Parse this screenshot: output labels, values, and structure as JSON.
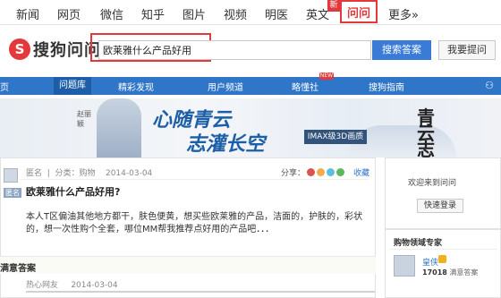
{
  "topnav": {
    "items": [
      "新闻",
      "网页",
      "微信",
      "知乎",
      "图片",
      "视频",
      "明医",
      "英文",
      "问问",
      "更多»"
    ],
    "new_badge": "新"
  },
  "logo": {
    "mark": "S",
    "text": "搜狗问问"
  },
  "search": {
    "value": "欧莱雅什么产品好用",
    "search_button": "搜索答案",
    "ask_button": "我要提问"
  },
  "channels": {
    "items": [
      "问题库",
      "精彩发现",
      "用户频道",
      "略懂社",
      "搜狗指南"
    ],
    "new_tag": "NEW"
  },
  "banner": {
    "slogan_line1": "心随青云",
    "slogan_line2": "志灌长空",
    "imax": "IMAX级3D画质",
    "scribble": "赵丽颖",
    "brush": "青云志"
  },
  "question": {
    "avatar_label": "匿名",
    "author": "匿名",
    "category": "分类：购物",
    "date": "2014-03-04",
    "share_label": "分享：",
    "favorite": "收藏",
    "title": "欧莱雅什么产品好用?",
    "body": "本人T区偏油其他地方都干，肤色便黄，想买些欧莱雅的产品，洁面的，护肤的，彩状的，想一次性购个全套，哪位MM帮我推荐点好用的产品吧．．．"
  },
  "answers": {
    "heading": "满意答案",
    "answerer": "热心网友",
    "date": "2014-03-04"
  },
  "sidebar": {
    "welcome": "欢迎来到问问",
    "login_button": "快速登录",
    "expert_heading": "购物领域专家",
    "expert_name": "皇侠",
    "expert_stat_value": "17018",
    "expert_stat_label": "满意答案"
  },
  "colors": {
    "accent": "#e4393c",
    "channel_bar": "#2f75c8",
    "search_button": "#3a7bd5"
  }
}
